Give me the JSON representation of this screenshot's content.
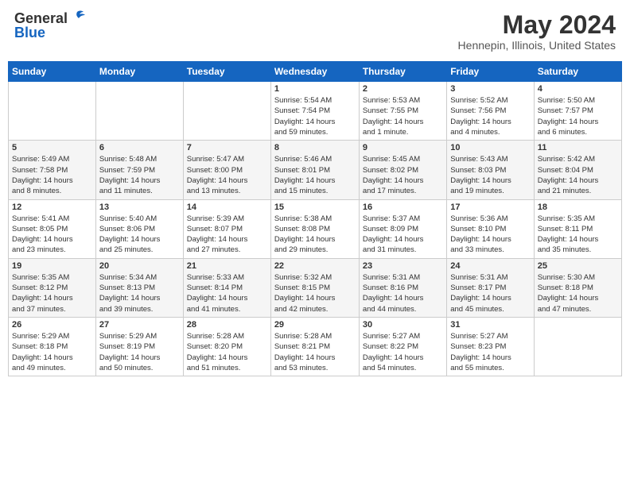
{
  "header": {
    "logo_general": "General",
    "logo_blue": "Blue",
    "month": "May 2024",
    "location": "Hennepin, Illinois, United States"
  },
  "days_of_week": [
    "Sunday",
    "Monday",
    "Tuesday",
    "Wednesday",
    "Thursday",
    "Friday",
    "Saturday"
  ],
  "weeks": [
    [
      {
        "day": "",
        "info": ""
      },
      {
        "day": "",
        "info": ""
      },
      {
        "day": "",
        "info": ""
      },
      {
        "day": "1",
        "info": "Sunrise: 5:54 AM\nSunset: 7:54 PM\nDaylight: 14 hours\nand 59 minutes."
      },
      {
        "day": "2",
        "info": "Sunrise: 5:53 AM\nSunset: 7:55 PM\nDaylight: 14 hours\nand 1 minute."
      },
      {
        "day": "3",
        "info": "Sunrise: 5:52 AM\nSunset: 7:56 PM\nDaylight: 14 hours\nand 4 minutes."
      },
      {
        "day": "4",
        "info": "Sunrise: 5:50 AM\nSunset: 7:57 PM\nDaylight: 14 hours\nand 6 minutes."
      }
    ],
    [
      {
        "day": "5",
        "info": "Sunrise: 5:49 AM\nSunset: 7:58 PM\nDaylight: 14 hours\nand 8 minutes."
      },
      {
        "day": "6",
        "info": "Sunrise: 5:48 AM\nSunset: 7:59 PM\nDaylight: 14 hours\nand 11 minutes."
      },
      {
        "day": "7",
        "info": "Sunrise: 5:47 AM\nSunset: 8:00 PM\nDaylight: 14 hours\nand 13 minutes."
      },
      {
        "day": "8",
        "info": "Sunrise: 5:46 AM\nSunset: 8:01 PM\nDaylight: 14 hours\nand 15 minutes."
      },
      {
        "day": "9",
        "info": "Sunrise: 5:45 AM\nSunset: 8:02 PM\nDaylight: 14 hours\nand 17 minutes."
      },
      {
        "day": "10",
        "info": "Sunrise: 5:43 AM\nSunset: 8:03 PM\nDaylight: 14 hours\nand 19 minutes."
      },
      {
        "day": "11",
        "info": "Sunrise: 5:42 AM\nSunset: 8:04 PM\nDaylight: 14 hours\nand 21 minutes."
      }
    ],
    [
      {
        "day": "12",
        "info": "Sunrise: 5:41 AM\nSunset: 8:05 PM\nDaylight: 14 hours\nand 23 minutes."
      },
      {
        "day": "13",
        "info": "Sunrise: 5:40 AM\nSunset: 8:06 PM\nDaylight: 14 hours\nand 25 minutes."
      },
      {
        "day": "14",
        "info": "Sunrise: 5:39 AM\nSunset: 8:07 PM\nDaylight: 14 hours\nand 27 minutes."
      },
      {
        "day": "15",
        "info": "Sunrise: 5:38 AM\nSunset: 8:08 PM\nDaylight: 14 hours\nand 29 minutes."
      },
      {
        "day": "16",
        "info": "Sunrise: 5:37 AM\nSunset: 8:09 PM\nDaylight: 14 hours\nand 31 minutes."
      },
      {
        "day": "17",
        "info": "Sunrise: 5:36 AM\nSunset: 8:10 PM\nDaylight: 14 hours\nand 33 minutes."
      },
      {
        "day": "18",
        "info": "Sunrise: 5:35 AM\nSunset: 8:11 PM\nDaylight: 14 hours\nand 35 minutes."
      }
    ],
    [
      {
        "day": "19",
        "info": "Sunrise: 5:35 AM\nSunset: 8:12 PM\nDaylight: 14 hours\nand 37 minutes."
      },
      {
        "day": "20",
        "info": "Sunrise: 5:34 AM\nSunset: 8:13 PM\nDaylight: 14 hours\nand 39 minutes."
      },
      {
        "day": "21",
        "info": "Sunrise: 5:33 AM\nSunset: 8:14 PM\nDaylight: 14 hours\nand 41 minutes."
      },
      {
        "day": "22",
        "info": "Sunrise: 5:32 AM\nSunset: 8:15 PM\nDaylight: 14 hours\nand 42 minutes."
      },
      {
        "day": "23",
        "info": "Sunrise: 5:31 AM\nSunset: 8:16 PM\nDaylight: 14 hours\nand 44 minutes."
      },
      {
        "day": "24",
        "info": "Sunrise: 5:31 AM\nSunset: 8:17 PM\nDaylight: 14 hours\nand 45 minutes."
      },
      {
        "day": "25",
        "info": "Sunrise: 5:30 AM\nSunset: 8:18 PM\nDaylight: 14 hours\nand 47 minutes."
      }
    ],
    [
      {
        "day": "26",
        "info": "Sunrise: 5:29 AM\nSunset: 8:18 PM\nDaylight: 14 hours\nand 49 minutes."
      },
      {
        "day": "27",
        "info": "Sunrise: 5:29 AM\nSunset: 8:19 PM\nDaylight: 14 hours\nand 50 minutes."
      },
      {
        "day": "28",
        "info": "Sunrise: 5:28 AM\nSunset: 8:20 PM\nDaylight: 14 hours\nand 51 minutes."
      },
      {
        "day": "29",
        "info": "Sunrise: 5:28 AM\nSunset: 8:21 PM\nDaylight: 14 hours\nand 53 minutes."
      },
      {
        "day": "30",
        "info": "Sunrise: 5:27 AM\nSunset: 8:22 PM\nDaylight: 14 hours\nand 54 minutes."
      },
      {
        "day": "31",
        "info": "Sunrise: 5:27 AM\nSunset: 8:23 PM\nDaylight: 14 hours\nand 55 minutes."
      },
      {
        "day": "",
        "info": ""
      }
    ]
  ]
}
